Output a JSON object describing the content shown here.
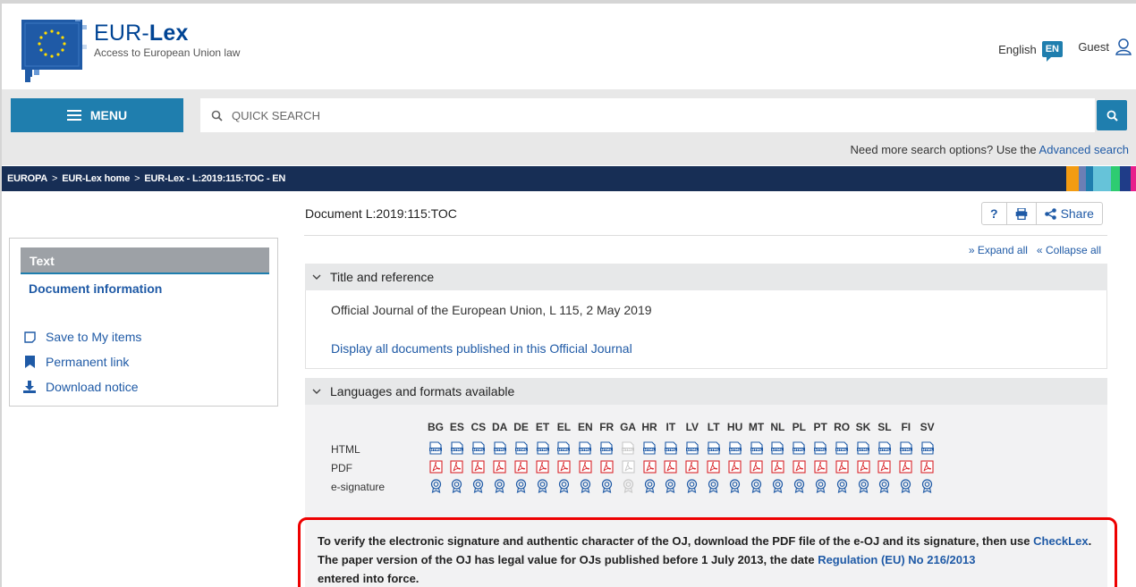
{
  "header": {
    "brand_light": "EUR-",
    "brand_bold": "Lex",
    "tagline": "Access to European Union law",
    "language": "English",
    "language_code": "EN",
    "user": "Guest"
  },
  "search": {
    "menu_label": "MENU",
    "placeholder": "QUICK SEARCH",
    "advanced_prefix": "Need more search options? Use the",
    "advanced_link": "Advanced search"
  },
  "breadcrumb": {
    "items": [
      "EUROPA",
      "EUR-Lex home",
      "EUR-Lex - L:2019:115:TOC - EN"
    ],
    "separator": ">",
    "colors": [
      "#f39c12",
      "#6b7fb5",
      "#1f7eae",
      "#66c3d9",
      "#2ecc71",
      "#1f3c88",
      "#e91e8c"
    ]
  },
  "sidebar": {
    "heading": "Text",
    "document_info": "Document information",
    "items": [
      {
        "label": "Save to My items",
        "icon": "bookmark-outline-icon"
      },
      {
        "label": "Permanent link",
        "icon": "bookmark-filled-icon"
      },
      {
        "label": "Download notice",
        "icon": "download-icon"
      }
    ]
  },
  "main": {
    "document_title": "Document L:2019:115:TOC",
    "tools": {
      "help": "?",
      "share": "Share"
    },
    "expand_all": "Expand all",
    "collapse_all": "Collapse all",
    "title_panel": {
      "heading": "Title and reference",
      "reference": "Official Journal of the European Union, L 115, 2 May 2019",
      "display_link": "Display all documents published in this Official Journal"
    },
    "languages_panel": {
      "heading": "Languages and formats available",
      "row_labels": [
        "HTML",
        "PDF",
        "e-signature"
      ],
      "languages": [
        "BG",
        "ES",
        "CS",
        "DA",
        "DE",
        "ET",
        "EL",
        "EN",
        "FR",
        "GA",
        "HR",
        "IT",
        "LV",
        "LT",
        "HU",
        "MT",
        "NL",
        "PL",
        "PT",
        "RO",
        "SK",
        "SL",
        "FI",
        "SV"
      ],
      "unavailable": [
        "GA"
      ]
    },
    "notice": {
      "part1": "To verify the electronic signature and authentic character of the OJ, download the PDF file of the e-OJ and its signature, then use",
      "checklex": "CheckLex",
      "part2": ". The paper version of the OJ has legal value for OJs published before 1 July 2013, the date",
      "regulation": "Regulation (EU) No 216/2013",
      "part3": "entered into force."
    }
  }
}
